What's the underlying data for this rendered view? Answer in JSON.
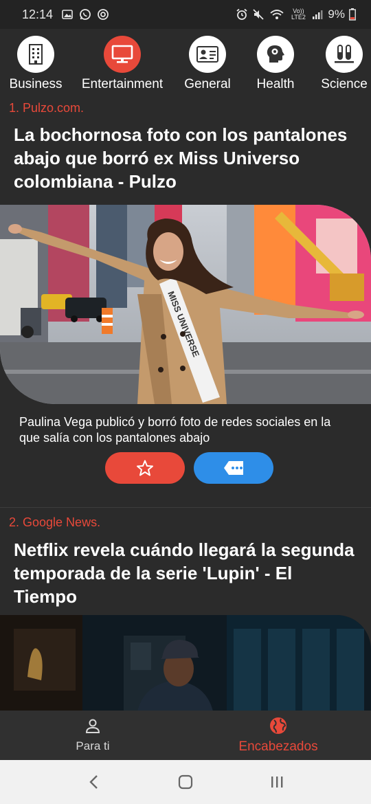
{
  "status_bar": {
    "time": "12:14",
    "left_icons": [
      "image-icon",
      "whatsapp-icon",
      "sync-icon"
    ],
    "right_icons": [
      "alarm-icon",
      "mute-icon",
      "wifi-calling-icon",
      "signal-icon"
    ],
    "network_label": "Vo)) LTE2",
    "battery": "9%"
  },
  "categories": [
    {
      "label": "Business",
      "icon": "building-icon",
      "active": false
    },
    {
      "label": "Entertainment",
      "icon": "monitor-icon",
      "active": true
    },
    {
      "label": "General",
      "icon": "id-card-icon",
      "active": false
    },
    {
      "label": "Health",
      "icon": "head-brain-icon",
      "active": false
    },
    {
      "label": "Science",
      "icon": "test-tubes-icon",
      "active": false
    }
  ],
  "articles": [
    {
      "source": "1. Pulzo.com.",
      "headline": "La bochornosa foto con los pantalones abajo que borró ex Miss Universo colombiana - Pulzo",
      "image_alt": "woman-in-sash-times-square-photo",
      "sash_text": "MISS UNIVERSE",
      "description": "Paulina Vega publicó y borró foto de redes sociales en la que salía con los pantalones abajo"
    },
    {
      "source": "2. Google News.",
      "headline": "Netflix revela cuándo llegará la segunda temporada de la serie 'Lupin' - El Tiempo",
      "image_alt": "man-in-cap-dark-room-photo"
    }
  ],
  "bottom_nav": {
    "for_you": "Para ti",
    "headlines": "Encabezados",
    "active": "headlines"
  },
  "colors": {
    "accent": "#e8493a",
    "share": "#2e8ee8",
    "background": "#2b2b2b"
  }
}
